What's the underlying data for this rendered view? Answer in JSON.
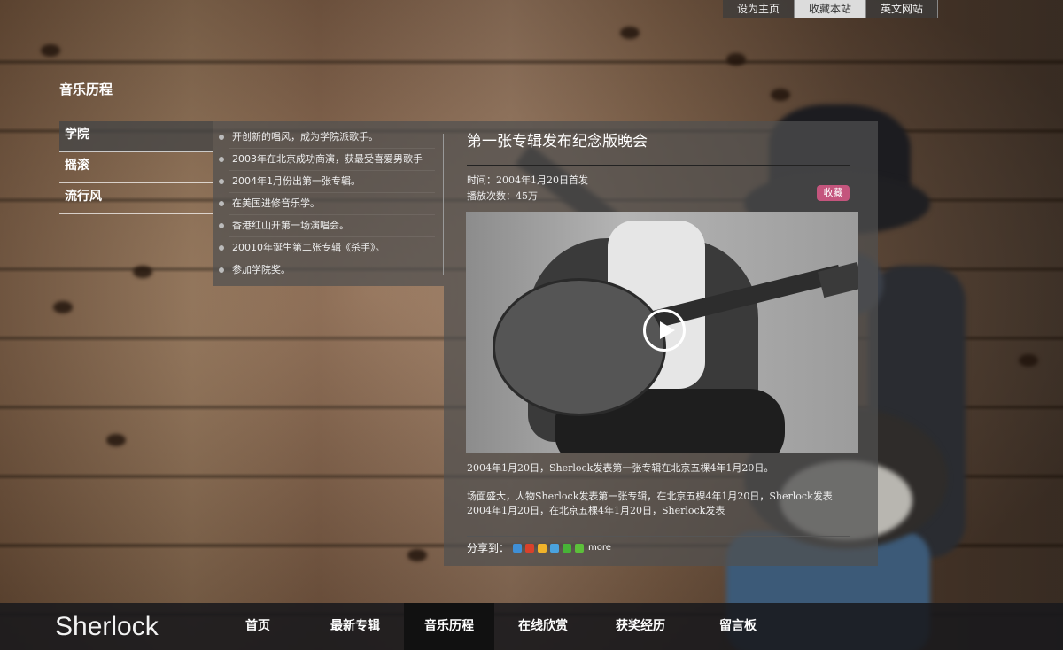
{
  "toplinks": {
    "home": "设为主页",
    "bookmark": "收藏本站",
    "english": "英文网站"
  },
  "page": {
    "title": "音乐历程"
  },
  "categories": [
    {
      "label": "学院"
    },
    {
      "label": "摇滚"
    },
    {
      "label": "流行风"
    }
  ],
  "timeline": [
    "开创新的唱风，成为学院派歌手。",
    "2003年在北京成功商演，获最受喜爱男歌手",
    "2004年1月份出第一张专辑。",
    "在美国进修音乐学。",
    "香港红山开第一场演唱会。",
    "20010年诞生第二张专辑《杀手》。",
    "参加学院奖。"
  ],
  "detail": {
    "title": "第一张专辑发布纪念版晚会",
    "time": "时间：2004年1月20日首发",
    "plays": "播放次数：45万",
    "favorite": "收藏",
    "para1": "2004年1月20日，Sherlock发表第一张专辑在北京五棵4年1月20日。",
    "para2": "场面盛大，人物Sherlock发表第一张专辑，在北京五棵4年1月20日，Sherlock发表2004年1月20日，在北京五棵4年1月20日，Sherlock发表",
    "share_label": "分享到：",
    "share_more": "more",
    "share_icons": [
      "qq-icon",
      "sina-weibo-icon",
      "qzone-icon",
      "tencent-weibo-icon",
      "wechat-icon",
      "plus-icon"
    ]
  },
  "brand": {
    "logo": "Sherlock"
  },
  "nav": [
    {
      "label": "首页"
    },
    {
      "label": "最新专辑"
    },
    {
      "label": "音乐历程"
    },
    {
      "label": "在线欣赏"
    },
    {
      "label": "获奖经历"
    },
    {
      "label": "留言板"
    }
  ],
  "colors": {
    "favorite_button": "#c4557d",
    "nav_bar": "#19191c",
    "nav_active": "#111111"
  }
}
